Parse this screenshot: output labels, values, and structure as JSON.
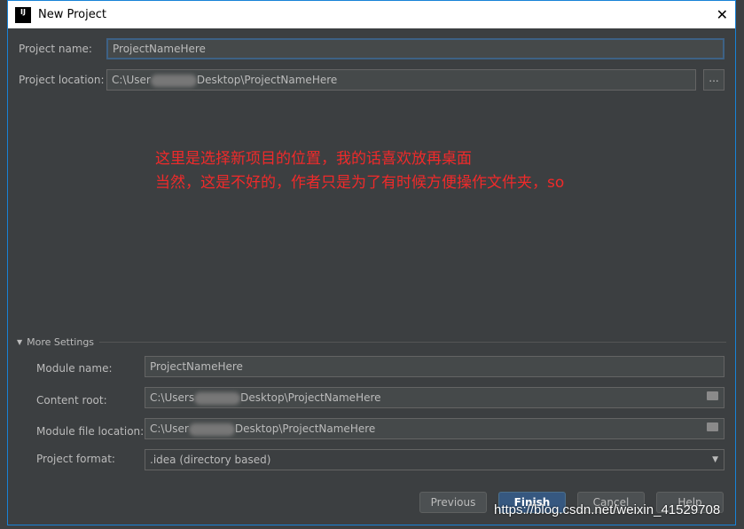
{
  "window": {
    "title": "New Project",
    "close": "✕"
  },
  "project_name": {
    "label": "Project name:",
    "value": "ProjectNameHere"
  },
  "project_location": {
    "label": "Project location:",
    "prefix": "C:\\User",
    "suffix": "Desktop\\ProjectNameHere",
    "browse": "..."
  },
  "annotation": {
    "line1": "这里是选择新项目的位置，我的话喜欢放再桌面",
    "line2": "当然，这是不好的，作者只是为了有时候方便操作文件夹，so"
  },
  "more_settings": {
    "label": "More Settings",
    "module_name": {
      "label": "Module name:",
      "value": "ProjectNameHere"
    },
    "content_root": {
      "label": "Content root:",
      "prefix": "C:\\Users",
      "suffix": "Desktop\\ProjectNameHere"
    },
    "module_file_location": {
      "label": "Module file location:",
      "prefix": "C:\\User",
      "suffix": "Desktop\\ProjectNameHere"
    },
    "project_format": {
      "label": "Project format:",
      "value": ".idea (directory based)"
    }
  },
  "buttons": {
    "previous": "Previous",
    "finish": "Finish",
    "cancel": "Cancel",
    "help": "Help"
  },
  "watermark": "https://blog.csdn.net/weixin_41529708"
}
